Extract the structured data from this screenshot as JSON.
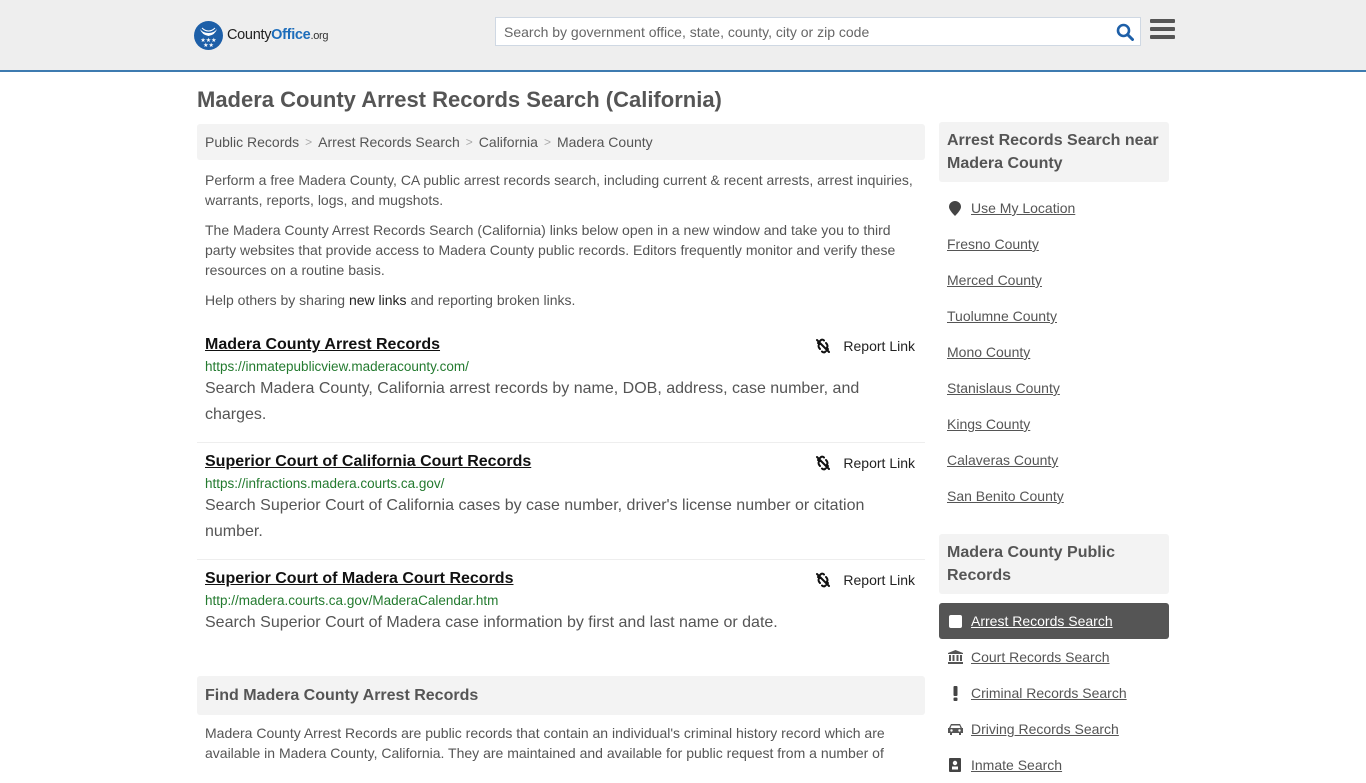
{
  "header": {
    "logo": {
      "county": "County",
      "office": "Office",
      "tld": ".org"
    },
    "search_placeholder": "Search by government office, state, county, city or zip code",
    "search_icon": "search-icon",
    "menu_icon": "hamburger-icon"
  },
  "page_title": "Madera County Arrest Records Search (California)",
  "breadcrumb": [
    {
      "label": "Public Records"
    },
    {
      "label": "Arrest Records Search"
    },
    {
      "label": "California"
    },
    {
      "label": "Madera County"
    }
  ],
  "breadcrumb_separator": ">",
  "intro": {
    "p1": "Perform a free Madera County, CA public arrest records search, including current & recent arrests, arrest inquiries, warrants, reports, logs, and mugshots.",
    "p2": "The Madera County Arrest Records Search (California) links below open in a new window and take you to third party websites that provide access to Madera County public records. Editors frequently monitor and verify these resources on a routine basis.",
    "p3_before": "Help others by sharing ",
    "p3_link": "new links",
    "p3_after": " and reporting broken links."
  },
  "report_label": "Report Link",
  "results": [
    {
      "title": "Madera County Arrest Records",
      "url": "https://inmatepublicview.maderacounty.com/",
      "description": "Search Madera County, California arrest records by name, DOB, address, case number, and charges."
    },
    {
      "title": "Superior Court of California Court Records",
      "url": "https://infractions.madera.courts.ca.gov/",
      "description": "Search Superior Court of California cases by case number, driver's license number or citation number."
    },
    {
      "title": "Superior Court of Madera Court Records",
      "url": "http://madera.courts.ca.gov/MaderaCalendar.htm",
      "description": "Search Superior Court of Madera case information by first and last name or date."
    }
  ],
  "find_section": {
    "heading": "Find Madera County Arrest Records",
    "text": "Madera County Arrest Records are public records that contain an individual's criminal history record which are available in Madera County, California. They are maintained and available for public request from a number of"
  },
  "sidebar": {
    "nearby_heading": "Arrest Records Search near Madera County",
    "use_location": "Use My Location",
    "nearby": [
      "Fresno County",
      "Merced County",
      "Tuolumne County",
      "Mono County",
      "Stanislaus County",
      "Kings County",
      "Calaveras County",
      "San Benito County"
    ],
    "public_heading": "Madera County Public Records",
    "public_records": [
      {
        "label": "Arrest Records Search",
        "icon": "square-icon",
        "active": true
      },
      {
        "label": "Court Records Search",
        "icon": "courthouse-icon",
        "active": false
      },
      {
        "label": "Criminal Records Search",
        "icon": "exclamation-icon",
        "active": false
      },
      {
        "label": "Driving Records Search",
        "icon": "car-icon",
        "active": false
      },
      {
        "label": "Inmate Search",
        "icon": "inmate-icon",
        "active": false
      }
    ]
  },
  "colors": {
    "header_bg": "#eeeeee",
    "header_border": "#3e7bb0",
    "brand_blue": "#1d5fa8",
    "url_green": "#237a2f",
    "active_bg": "#555555"
  }
}
